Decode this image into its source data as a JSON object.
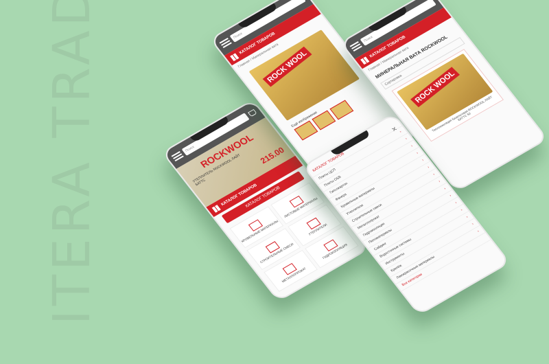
{
  "brand": {
    "text": "ITERA TRADE"
  },
  "phone1": {
    "search_placeholder": "Поиск",
    "banner_brand": "ROCKWOOL",
    "banner_text": "УТЕПЛИТЕЛЬ ROCKWOOL ЛАЙТ БАТТС",
    "banner_price": "215.00",
    "catalog_label": "КАТАЛОГ ТОВАРОВ",
    "catalog_btn": "КАТАЛОГ ТОВАРОВ",
    "cats": [
      "КРОВЕЛЬНЫЕ МАТЕРИАЛЫ",
      "ЛИСТОВЫЕ МАТЕРИАЛЫ",
      "СТРОИТЕЛЬНЫЕ СМЕСИ",
      "УТЕПЛИТЕЛИ",
      "МЕТАЛЛОПРОКАТ",
      "ГИДРОИЗОЛЯЦИЯ"
    ]
  },
  "phone2": {
    "search_placeholder": "Поиск",
    "catalog_label": "КАТАЛОГ ТОВАРОВ",
    "crumbs": "Главная / Минеральная вата",
    "product_brand": "ROCK WOOL",
    "gallery_label": "Ещё изображения"
  },
  "phone3": {
    "search_placeholder": "Поиск",
    "catalog_label": "КАТАЛОГ ТОВАРОВ",
    "crumbs": "Главная / Минеральная вата",
    "title": "МИНЕРАЛЬНАЯ ВАТА ROCKWOOL",
    "filter": "Сортировка",
    "product_brand": "ROCK WOOL",
    "card_text": "Теплоизоляция базальтовая ROCKWOOL ЛАЙТ БАТТС 50"
  },
  "phone4": {
    "header": "КАТАЛОГ ТОВАРОВ",
    "items": [
      "Плиты ЦСП",
      "Плиты OSB",
      "Гипсокартон",
      "Фанера",
      "Кровельные материалы",
      "Утеплители",
      "Строительные смеси",
      "Металлопрокат",
      "Гидроизоляция",
      "Пиломатериалы",
      "Сайдинг",
      "Водосточные системы",
      "Инструменты",
      "Крепёж",
      "Лакокрасочные материалы"
    ],
    "footer_link": "Все категории"
  }
}
